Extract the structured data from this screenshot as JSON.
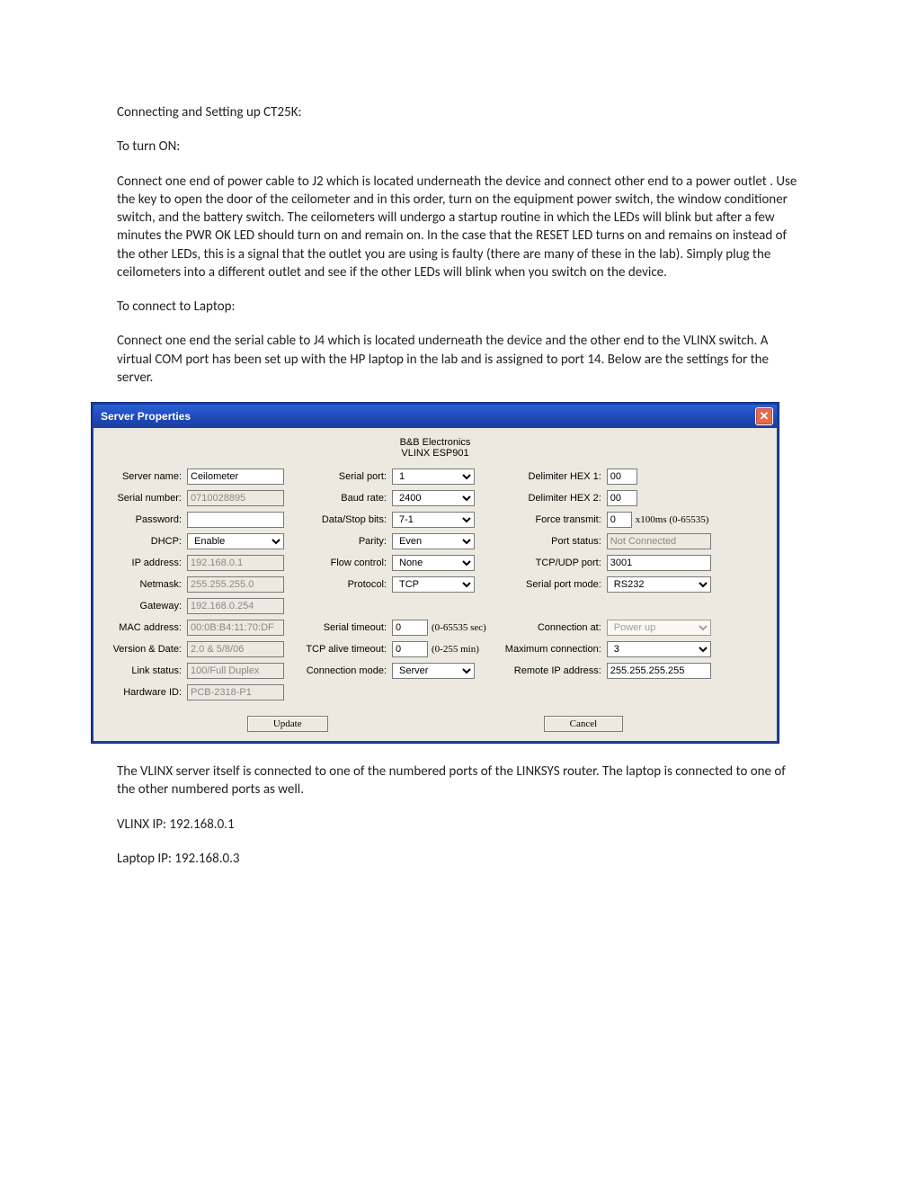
{
  "doc": {
    "title": "Connecting and Setting up CT25K:",
    "turn_on_heading": "To turn ON:",
    "turn_on_body": "Connect one end of power cable to J2 which is located underneath the device and connect other end to a power outlet .  Use the key to open the door of the ceilometer and in this order, turn on the equipment power switch, the window conditioner switch, and the battery switch.  The ceilometers will undergo a startup routine in which the LEDs will blink but after a few minutes the PWR OK LED should turn on and remain on.  In the case that the RESET LED turns on and remains on instead of the other LEDs, this is a signal that the outlet you are using is faulty (there are many of these in the lab).  Simply plug the ceilometers into a different outlet and see if the other LEDs will blink when you switch on the device.",
    "connect_heading": "To connect to Laptop:",
    "connect_body": "Connect one end the serial cable to J4 which is located underneath the device and the other end to the VLINX switch.  A virtual COM port has been set up with the HP laptop in the lab and is assigned to port 14. Below are the settings for the server.",
    "after1": "The VLINX server itself is connected to one of the numbered ports of the LINKSYS router.  The laptop is connected to one of the other numbered ports as well.",
    "after2": "VLINX IP:  192.168.0.1",
    "after3": "Laptop IP: 192.168.0.3"
  },
  "dialog": {
    "title": "Server Properties",
    "close_glyph": "✕",
    "banner1": "B&B Electronics",
    "banner2": "VLINX ESP901",
    "labels": {
      "server_name": "Server name:",
      "serial_number": "Serial number:",
      "password": "Password:",
      "dhcp": "DHCP:",
      "ip_address": "IP address:",
      "netmask": "Netmask:",
      "gateway": "Gateway:",
      "mac_address": "MAC address:",
      "version_date": "Version & Date:",
      "link_status": "Link status:",
      "hardware_id": "Hardware ID:",
      "serial_port": "Serial port:",
      "baud_rate": "Baud rate:",
      "data_stop": "Data/Stop bits:",
      "parity": "Parity:",
      "flow_control": "Flow control:",
      "protocol": "Protocol:",
      "serial_timeout": "Serial timeout:",
      "tcp_alive": "TCP alive timeout:",
      "conn_mode": "Connection mode:",
      "delim1": "Delimiter HEX 1:",
      "delim2": "Delimiter HEX 2:",
      "force_tx": "Force transmit:",
      "port_status": "Port status:",
      "tcpudp_port": "TCP/UDP port:",
      "spm": "Serial port mode:",
      "conn_at": "Connection at:",
      "max_conn": "Maximum connection:",
      "remote_ip": "Remote IP address:"
    },
    "values": {
      "server_name": "Ceilometer",
      "serial_number": "0710028895",
      "password": "",
      "dhcp": "Enable",
      "ip_address": "192.168.0.1",
      "netmask": "255.255.255.0",
      "gateway": "192.168.0.254",
      "mac_address": "00:0B:B4:11:70:DF",
      "version_date": "2.0 & 5/8/06",
      "link_status": "100/Full Duplex",
      "hardware_id": "PCB-2318-P1",
      "serial_port": "1",
      "baud_rate": "2400",
      "data_stop": "7-1",
      "parity": "Even",
      "flow_control": "None",
      "protocol": "TCP",
      "serial_timeout": "0",
      "tcp_alive": "0",
      "conn_mode": "Server",
      "delim1": "00",
      "delim2": "00",
      "force_tx": "0",
      "port_status": "Not Connected",
      "tcpudp_port": "3001",
      "spm": "RS232",
      "conn_at": "Power up",
      "max_conn": "3",
      "remote_ip": "255.255.255.255"
    },
    "hints": {
      "serial_timeout": "(0-65535 sec)",
      "tcp_alive": "(0-255 min)",
      "force_tx": "x100ms (0-65535)"
    },
    "buttons": {
      "update": "Update",
      "cancel": "Cancel"
    }
  }
}
